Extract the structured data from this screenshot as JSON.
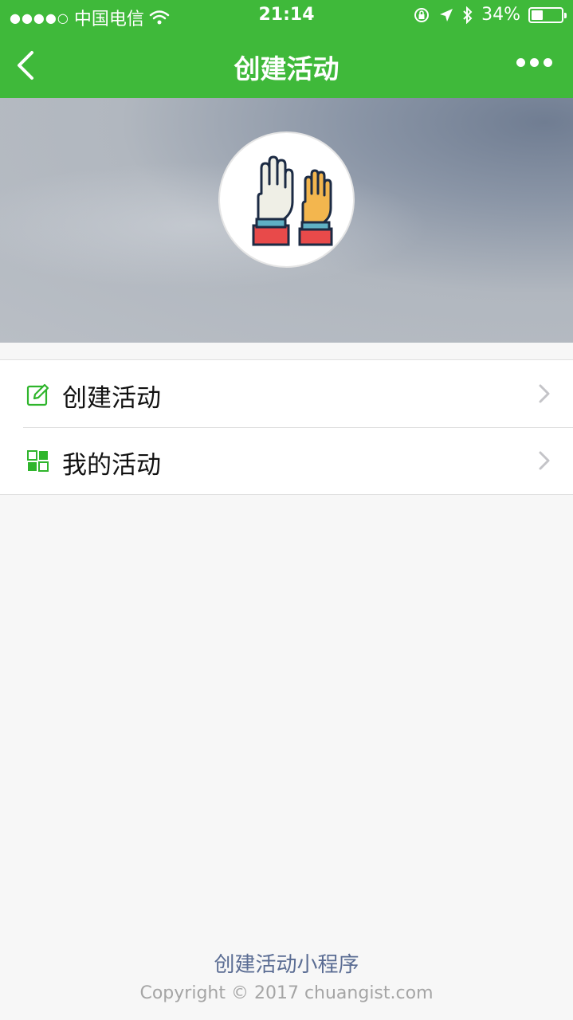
{
  "status_bar": {
    "signal_dots": "●●●●○",
    "carrier": "中国电信",
    "time": "21:14",
    "battery_percent": "34%"
  },
  "nav": {
    "title": "创建活动",
    "back_icon": "chevron-left-icon",
    "more_icon": "more-dots-icon"
  },
  "banner": {
    "avatar_icon": "raised-hands-icon"
  },
  "menu": {
    "items": [
      {
        "label": "创建活动",
        "icon": "edit-icon"
      },
      {
        "label": "我的活动",
        "icon": "grid-icon"
      }
    ]
  },
  "footer": {
    "title": "创建活动小程序",
    "copyright": "Copyright © 2017 chuangist.com"
  },
  "colors": {
    "brand_green": "#3fb93a",
    "footer_link": "#5a6c93"
  }
}
